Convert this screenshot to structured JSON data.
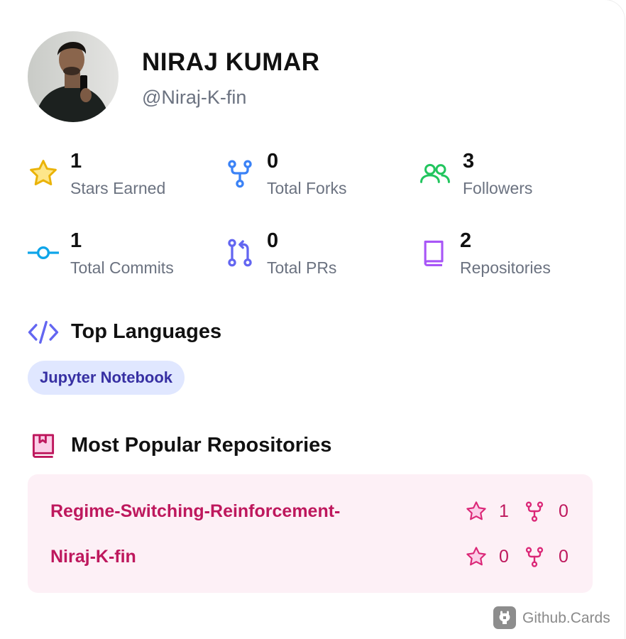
{
  "profile": {
    "name": "NIRAJ KUMAR",
    "handle": "@Niraj-K-fin"
  },
  "stats": [
    {
      "value": "1",
      "label": "Stars Earned",
      "icon": "star-icon",
      "color": "#eab308"
    },
    {
      "value": "0",
      "label": "Total Forks",
      "icon": "fork-icon",
      "color": "#3b82f6"
    },
    {
      "value": "3",
      "label": "Followers",
      "icon": "users-icon",
      "color": "#22c55e"
    },
    {
      "value": "1",
      "label": "Total Commits",
      "icon": "commit-icon",
      "color": "#0ea5e9"
    },
    {
      "value": "0",
      "label": "Total PRs",
      "icon": "pull-request-icon",
      "color": "#6366f1"
    },
    {
      "value": "2",
      "label": "Repositories",
      "icon": "book-icon",
      "color": "#a855f7"
    }
  ],
  "languages": {
    "title": "Top Languages",
    "icon": "code-icon",
    "items": [
      "Jupyter Notebook"
    ]
  },
  "repos": {
    "title": "Most Popular Repositories",
    "icon": "repo-book-icon",
    "items": [
      {
        "name": "Regime-Switching-Reinforcement-",
        "stars": "1",
        "forks": "0"
      },
      {
        "name": "Niraj-K-fin",
        "stars": "0",
        "forks": "0"
      }
    ]
  },
  "footer": {
    "brand": "Github.Cards",
    "icon": "github-icon"
  },
  "colors": {
    "accent_pink": "#be185d",
    "pill_bg": "#e0e7ff",
    "pill_text": "#3730a3",
    "muted": "#6b7280"
  }
}
